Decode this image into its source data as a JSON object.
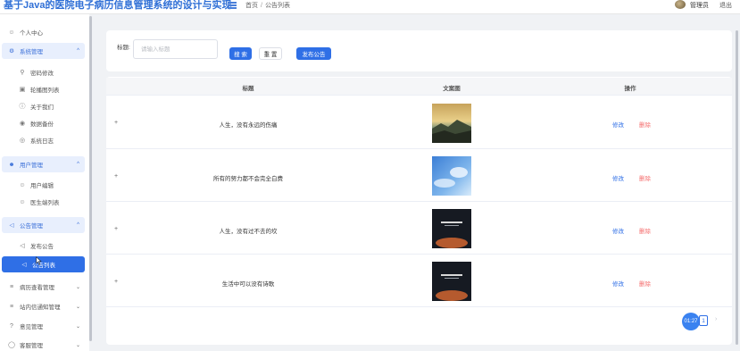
{
  "header": {
    "app_title": "基于Java的医院电子病历信息管理系统的设计与实现",
    "breadcrumb_home": "首页",
    "breadcrumb_sep": "/",
    "breadcrumb_current": "公告列表",
    "user_name": "管理员",
    "logout": "退出"
  },
  "sidebar": {
    "personal_center": "个人中心",
    "system_management": "系统管理",
    "password_change": "密码修改",
    "carousel_list": "轮播图列表",
    "about_us": "关于我们",
    "data_backup": "数据备份",
    "system_log": "系统日志",
    "user_management": "用户管理",
    "user_edit": "用户编辑",
    "doctor_list": "医生端列表",
    "notice_management": "公告管理",
    "publish_notice": "发布公告",
    "notice_list": "公告列表",
    "medical_record_view": "病历查看管理",
    "internal_message": "站内信通知管理",
    "feedback": "意见管理",
    "customer_service": "客服管理"
  },
  "search": {
    "label": "标题:",
    "placeholder": "请输入标题",
    "value": "",
    "search_button": "搜 索",
    "reset_button": "重 置",
    "publish_button": "发布公告"
  },
  "table": {
    "columns": [
      "标题",
      "文案图",
      "操作"
    ],
    "rows": [
      {
        "title": "人生，没有永远的伤痛",
        "image": "sunset-mountain",
        "edit": "修改",
        "delete": "删除"
      },
      {
        "title": "所有的努力都不会完全白费",
        "image": "blue-sky",
        "edit": "修改",
        "delete": "删除"
      },
      {
        "title": "人生，没有过不去的坎",
        "image": "dark-poster",
        "edit": "修改",
        "delete": "删除"
      },
      {
        "title": "生活中可以没有诗歌",
        "image": "dark-poster",
        "edit": "修改",
        "delete": "删除"
      }
    ],
    "expand_symbol": "+"
  },
  "pager": {
    "badge": "01:27",
    "current_page": "1",
    "next_symbol": "›"
  },
  "colors": {
    "primary": "#2f6fe6",
    "danger": "#f56c6c",
    "title": "#2f6fd6"
  }
}
